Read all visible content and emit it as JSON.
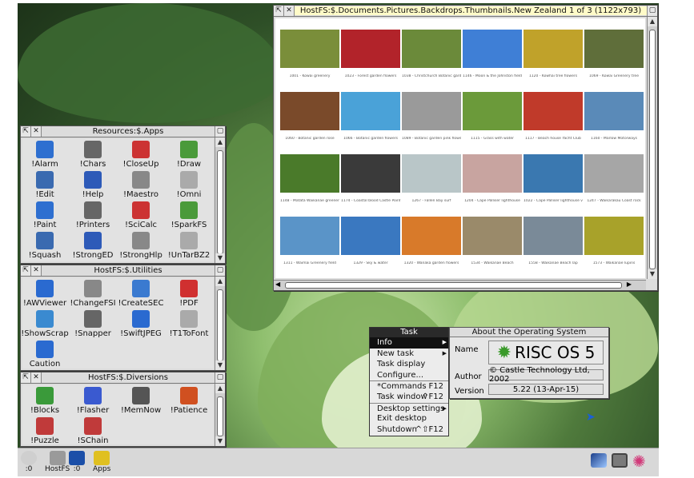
{
  "windows": {
    "thumbnails": {
      "title": "HostFS:$.Documents.Pictures.Backdrops.Thumbnails.New Zealand 1 of 3 (1122x793)",
      "captions": [
        [
          "1001 - Kowai greenery",
          "1023 - Forest garden flowers",
          "1038 - Christchurch Botanic garden",
          "1146 - Moon & the Johnston field",
          "1120 - Kowhai tree flowers",
          "1069 - Kowai Greenery tree"
        ],
        [
          "1060 - Botanic garden rose",
          "1066 - Botanic garden flowers",
          "1089 - Botanic garden pink flower",
          "1115 - Grass with water",
          "1117 - Beach house Yacht Club",
          "1160 - Marlow Motorways"
        ],
        [
          "1148 - Matata Waikanae greenery",
          "1174 - Coastal blood Castle Point",
          "1267 - Fallen Bay surf",
          "1204 - Cape Palliser lighthouse",
          "1022 - Cape Palliser lighthouse view",
          "1247 - Waikarakau Coast rock"
        ],
        [
          "1311 - Waimai Greenery field",
          "1329 - Sky & water",
          "1320 - Wanaka garden flowers",
          "1534 - Waikanae Beach",
          "1558 - Waikanae Beach lap",
          "1573 - Waikanae lupins"
        ]
      ]
    },
    "apps": {
      "title": "Resources:$.Apps",
      "icons": [
        "!Alarm",
        "!Chars",
        "!CloseUp",
        "!Draw",
        "!Edit",
        "!Help",
        "!Maestro",
        "!Omni",
        "!Paint",
        "!Printers",
        "!SciCalc",
        "!SparkFS",
        "!Squash",
        "!StrongED",
        "!StrongHlp",
        "!UnTarBZ2"
      ]
    },
    "utilities": {
      "title": "HostFS:$.Utilities",
      "icons": [
        "!AWViewer",
        "!ChangeFSI",
        "!CreateSEC",
        "!PDF",
        "!ShowScrap",
        "!Snapper",
        "!SwiftJPEG",
        "!T1ToFont",
        "Caution"
      ]
    },
    "diversions": {
      "title": "HostFS:$.Diversions",
      "icons": [
        "!Blocks",
        "!Flasher",
        "!MemNow",
        "!Patience",
        "!Puzzle",
        "!SChain"
      ]
    }
  },
  "task_menu": {
    "title": "Task",
    "items": [
      {
        "label": "Info",
        "shortcut": "",
        "submenu": true,
        "selected": true
      },
      {
        "label": "New task",
        "shortcut": "",
        "submenu": true
      },
      {
        "label": "Task display",
        "shortcut": ""
      },
      {
        "label": "Configure...",
        "shortcut": ""
      },
      {
        "label": "*Commands",
        "shortcut": "F12"
      },
      {
        "label": "Task window",
        "shortcut": "^F12"
      },
      {
        "label": "Desktop settings",
        "shortcut": "",
        "submenu": true
      },
      {
        "label": "Exit desktop",
        "shortcut": ""
      },
      {
        "label": "Shutdown",
        "shortcut": "^⇧F12"
      }
    ]
  },
  "about": {
    "title": "About the Operating System",
    "name_label": "Name",
    "name_value": "RISC OS 5",
    "author_label": "Author",
    "author_value": "© Castle Technology Ltd, 2002",
    "version_label": "Version",
    "version_value": "5.22 (13-Apr-15)"
  },
  "iconbar": {
    "left": [
      {
        "label": ":0",
        "icon": "cd-icon"
      },
      {
        "label": "HostFS",
        "icon": "harddisc-icon"
      },
      {
        "label": ":0",
        "icon": "floppy-icon"
      },
      {
        "label": "Apps",
        "icon": "apps-icon"
      }
    ],
    "right": [
      "display-icon",
      "task-manager-icon",
      "riscos-logo-icon"
    ]
  },
  "colors": {
    "menu_title_bg": "#2a2a2a",
    "selected_title": "#fffbc8",
    "window_bg": "#e2e2e2"
  }
}
